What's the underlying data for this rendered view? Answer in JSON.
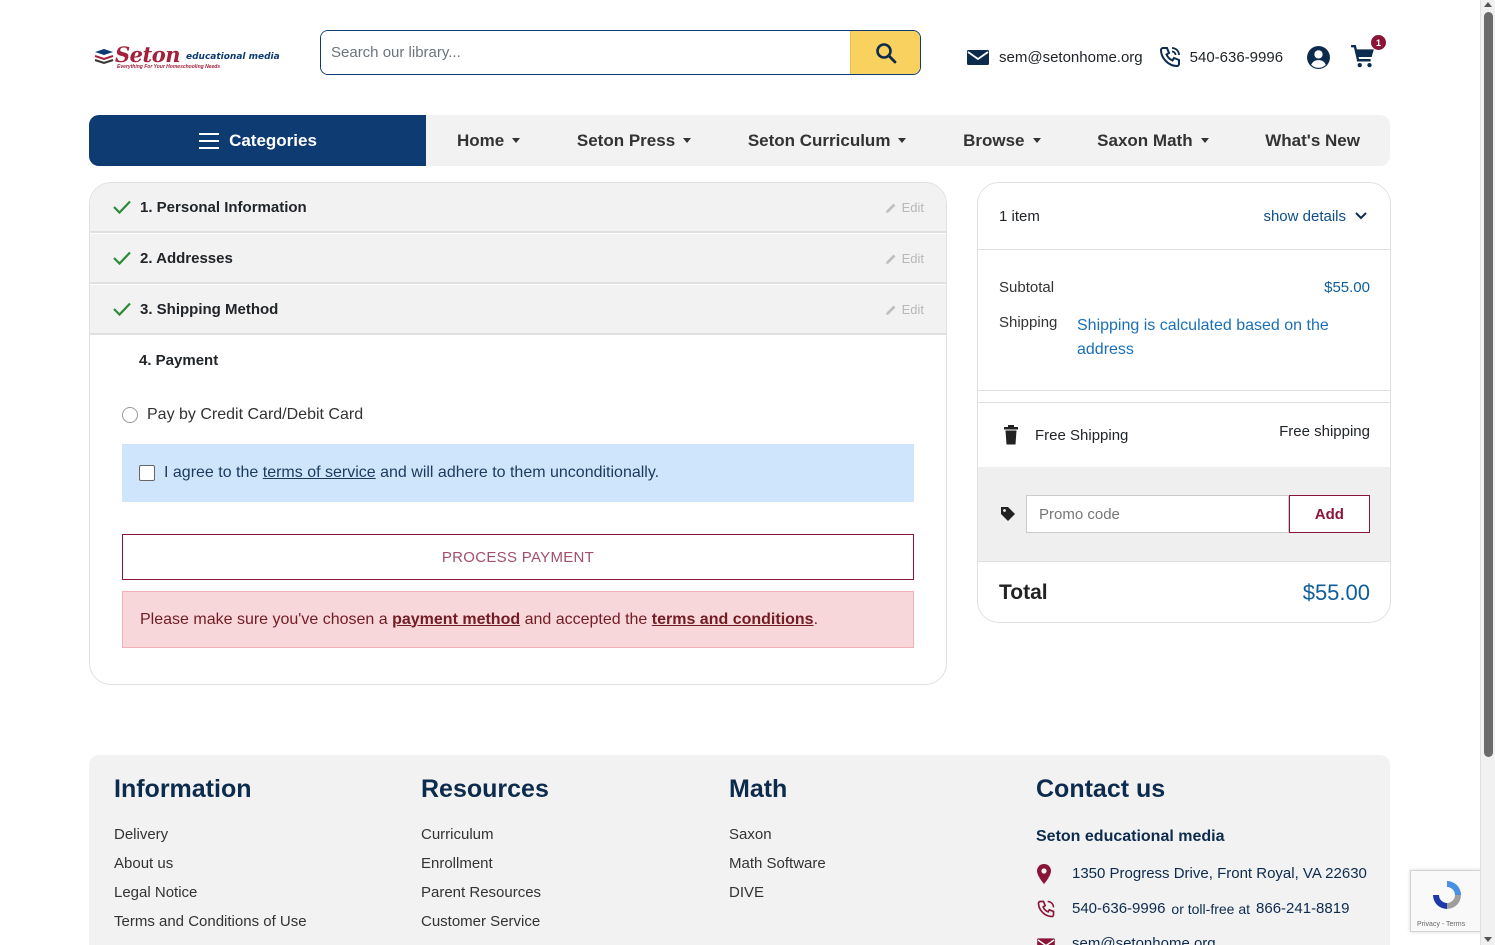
{
  "header": {
    "logo_text": "Seton",
    "logo_sub": "educational media",
    "logo_tagline": "Everything For Your Homeschooling Needs",
    "search_placeholder": "Search our library...",
    "email": "sem@setonhome.org",
    "phone": "540-636-9996",
    "cart_count": "1"
  },
  "nav": {
    "categories_label": "Categories",
    "items": [
      {
        "label": "Home",
        "dropdown": true
      },
      {
        "label": "Seton Press",
        "dropdown": true
      },
      {
        "label": "Seton Curriculum",
        "dropdown": true
      },
      {
        "label": "Browse",
        "dropdown": true
      },
      {
        "label": "Saxon Math",
        "dropdown": true
      },
      {
        "label": "What's New",
        "dropdown": false
      }
    ]
  },
  "checkout": {
    "steps": [
      {
        "title": "1. Personal Information",
        "edit": "Edit",
        "done": true
      },
      {
        "title": "2. Addresses",
        "edit": "Edit",
        "done": true
      },
      {
        "title": "3. Shipping Method",
        "edit": "Edit",
        "done": true
      }
    ],
    "payment_title": "4. Payment",
    "payment_option": "Pay by Credit Card/Debit Card",
    "tos_prefix": "I agree to the",
    "tos_link": "terms of service",
    "tos_suffix": "and will adhere to them unconditionally.",
    "process_button": "PROCESS PAYMENT",
    "alert_prefix": "Please make sure you've chosen a",
    "alert_link1": "payment method",
    "alert_middle": "and accepted the",
    "alert_link2": "terms and conditions",
    "alert_suffix": "."
  },
  "summary": {
    "item_count": "1 item",
    "show_details": "show details",
    "subtotal_label": "Subtotal",
    "subtotal_value": "$55.00",
    "shipping_label": "Shipping",
    "shipping_value": "Shipping is calculated based on the address",
    "shipping_option_name": "Free Shipping",
    "shipping_option_price": "Free shipping",
    "promo_placeholder": "Promo code",
    "promo_button": "Add",
    "total_label": "Total",
    "total_value": "$55.00"
  },
  "footer": {
    "information": {
      "heading": "Information",
      "links": [
        "Delivery",
        "About us",
        "Legal Notice",
        "Terms and Conditions of Use"
      ]
    },
    "resources": {
      "heading": "Resources",
      "links": [
        "Curriculum",
        "Enrollment",
        "Parent Resources",
        "Customer Service"
      ]
    },
    "math": {
      "heading": "Math",
      "links": [
        "Saxon",
        "Math Software",
        "DIVE"
      ]
    },
    "contact": {
      "heading": "Contact us",
      "org": "Seton educational media",
      "address": "1350 Progress Drive, Front Royal, VA 22630",
      "phone": "540-636-9996",
      "tollfree_text": "or toll-free at",
      "tollfree": "866-241-8819",
      "email": "sem@setonhome.org"
    }
  },
  "recaptcha": {
    "text": "Privacy - Terms"
  },
  "colors": {
    "brand_navy": "#0d3b72",
    "brand_maroon": "#8a1538",
    "search_yellow": "#f8d15e",
    "link_blue": "#1a6fb8"
  }
}
